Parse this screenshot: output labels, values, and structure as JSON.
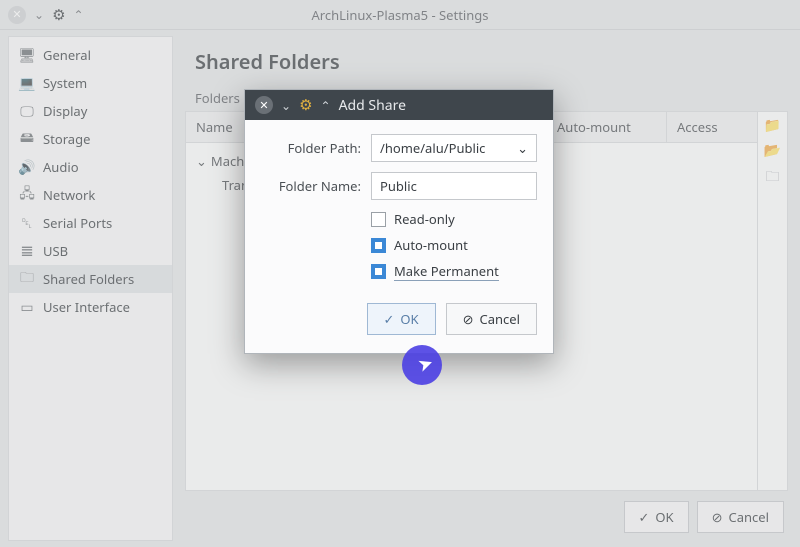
{
  "main_window": {
    "title": "ArchLinux-Plasma5 - Settings",
    "sidebar": [
      {
        "icon": "🖥",
        "label": "General"
      },
      {
        "icon": "💻",
        "label": "System"
      },
      {
        "icon": "🖵",
        "label": "Display"
      },
      {
        "icon": "🖴",
        "label": "Storage"
      },
      {
        "icon": "🔊",
        "label": "Audio"
      },
      {
        "icon": "🖧",
        "label": "Network"
      },
      {
        "icon": "␡",
        "label": "Serial Ports"
      },
      {
        "icon": "𝌆",
        "label": "USB"
      },
      {
        "icon": "🗀",
        "label": "Shared Folders",
        "selected": true
      },
      {
        "icon": "▭",
        "label": "User Interface"
      }
    ],
    "page_title": "Shared Folders",
    "folders_label": "Folders Li",
    "columns": {
      "name": "Name",
      "auto": "Auto-mount",
      "access": "Access"
    },
    "tree": {
      "root_prefix": "Mach",
      "child_prefix": "Tran"
    },
    "footer": {
      "ok": "OK",
      "cancel": "Cancel"
    }
  },
  "dialog": {
    "title": "Add Share",
    "labels": {
      "folder_path": "Folder Path:",
      "folder_name": "Folder Name:"
    },
    "values": {
      "folder_path": "/home/alu/Public",
      "folder_name": "Public"
    },
    "checks": {
      "read_only": {
        "label": "Read-only",
        "checked": false
      },
      "auto_mount": {
        "label": "Auto-mount",
        "checked": true
      },
      "make_permanent": {
        "label": "Make Permanent",
        "checked": true
      }
    },
    "buttons": {
      "ok": "OK",
      "cancel": "Cancel"
    }
  }
}
